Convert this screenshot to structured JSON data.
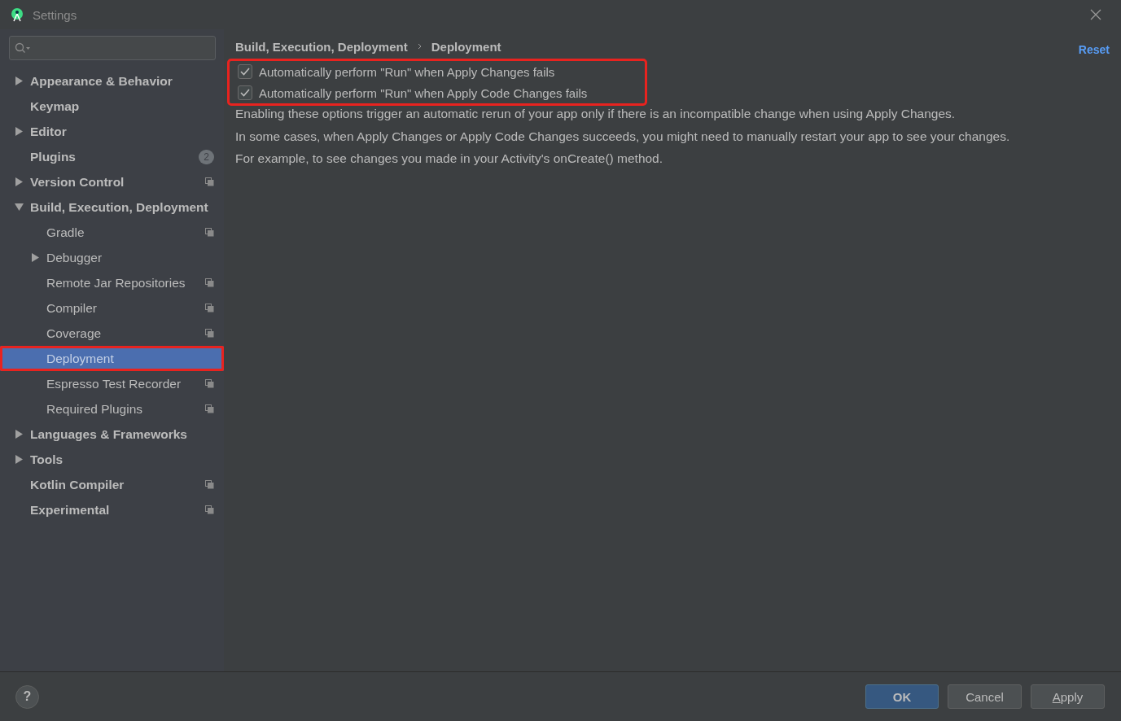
{
  "window": {
    "title": "Settings"
  },
  "sidebar": {
    "items": [
      {
        "label": "Appearance & Behavior",
        "expanded": false,
        "selected": false,
        "highlighted": false
      },
      {
        "label": "Keymap",
        "selected": false,
        "highlighted": false
      },
      {
        "label": "Editor",
        "expanded": false,
        "selected": false,
        "highlighted": false
      },
      {
        "label": "Plugins",
        "badge": "2",
        "selected": false,
        "highlighted": false
      },
      {
        "label": "Version Control",
        "expanded": false,
        "project_level": true,
        "selected": false,
        "highlighted": false
      },
      {
        "label": "Build, Execution, Deployment",
        "expanded": true,
        "selected": false,
        "highlighted": false,
        "children": [
          {
            "label": "Gradle",
            "project_level": true,
            "selected": false,
            "highlighted": false
          },
          {
            "label": "Debugger",
            "expanded": false,
            "selected": false,
            "highlighted": false
          },
          {
            "label": "Remote Jar Repositories",
            "project_level": true,
            "selected": false,
            "highlighted": false
          },
          {
            "label": "Compiler",
            "project_level": true,
            "selected": false,
            "highlighted": false
          },
          {
            "label": "Coverage",
            "project_level": true,
            "selected": false,
            "highlighted": false
          },
          {
            "label": "Deployment",
            "selected": true,
            "highlighted": true
          },
          {
            "label": "Espresso Test Recorder",
            "project_level": true,
            "selected": false,
            "highlighted": false
          },
          {
            "label": "Required Plugins",
            "project_level": true,
            "selected": false,
            "highlighted": false
          }
        ]
      },
      {
        "label": "Languages & Frameworks",
        "expanded": false,
        "selected": false,
        "highlighted": false
      },
      {
        "label": "Tools",
        "expanded": false,
        "selected": false,
        "highlighted": false
      },
      {
        "label": "Kotlin Compiler",
        "project_level": true,
        "selected": false,
        "highlighted": false
      },
      {
        "label": "Experimental",
        "project_level": true,
        "selected": false,
        "highlighted": false
      }
    ]
  },
  "breadcrumb": [
    "Build, Execution, Deployment",
    "Deployment"
  ],
  "reset": "Reset",
  "options": {
    "highlighted": true,
    "items": [
      {
        "label": "Automatically perform \"Run\" when Apply Changes fails",
        "checked": true
      },
      {
        "label": "Automatically perform \"Run\" when Apply Code Changes fails",
        "checked": true
      }
    ]
  },
  "description": [
    "Enabling these options trigger an automatic rerun of your app only if there is an incompatible change when using Apply Changes.",
    "In some cases, when Apply Changes or Apply Code Changes succeeds, you might need to manually restart your app to see your changes.",
    "For example, to see changes you made in your Activity's onCreate() method."
  ],
  "help": "?",
  "buttons": [
    {
      "label": "OK",
      "kind": "primary"
    },
    {
      "label": "Cancel",
      "kind": "normal"
    },
    {
      "label": "Apply",
      "kind": "mnemonic"
    }
  ]
}
